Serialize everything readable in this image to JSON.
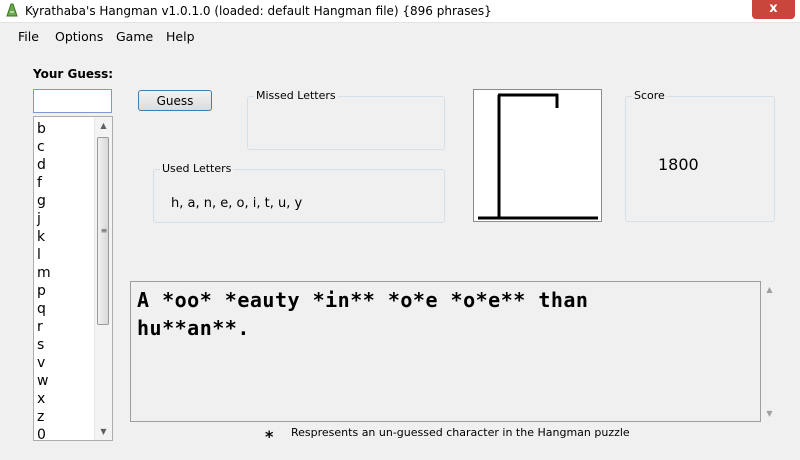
{
  "window": {
    "title": "Kyrathaba's Hangman v1.0.1.0 (loaded: default Hangman file) {896 phrases}",
    "close_glyph": "x"
  },
  "menu": [
    {
      "label": "File"
    },
    {
      "label": "Options"
    },
    {
      "label": "Game"
    },
    {
      "label": "Help"
    }
  ],
  "guess": {
    "label": "Your Guess:",
    "input_value": "",
    "button_label": "Guess"
  },
  "available_letters": [
    "b",
    "c",
    "d",
    "f",
    "g",
    "j",
    "k",
    "l",
    "m",
    "p",
    "q",
    "r",
    "s",
    "v",
    "w",
    "x",
    "z",
    "0"
  ],
  "missed_letters": {
    "label": "Missed Letters",
    "value": ""
  },
  "used_letters": {
    "label": "Used Letters",
    "value": "h, a, n, e, o, i, t, u, y"
  },
  "score": {
    "label": "Score",
    "value": "1800"
  },
  "hangman_stage": 0,
  "puzzle": {
    "line1": "A *oo* *eauty *in** *o*e *o*e** than",
    "line2": "hu**an**."
  },
  "legend": {
    "symbol": "*",
    "text": "Respresents an un-guessed character in the Hangman puzzle"
  },
  "icons": {
    "app": "hangman-app-icon",
    "list_scroll_up": "arrow-up-icon",
    "list_scroll_down": "arrow-down-icon",
    "list_scroll_grip": "grip-icon"
  },
  "colors": {
    "window_bg": "#f0f0f0",
    "close_button": "#c9463d",
    "input_border": "#7a9cd3"
  }
}
